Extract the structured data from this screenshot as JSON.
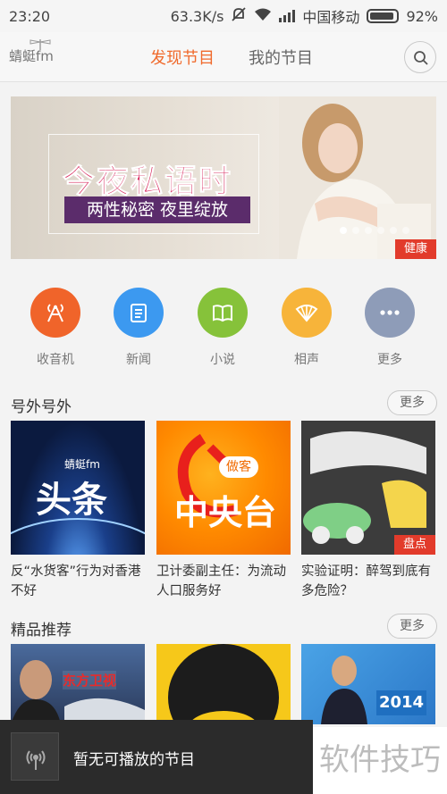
{
  "status_bar": {
    "time": "23:20",
    "net_speed": "63.3K/s",
    "carrier": "中国移动",
    "battery": "92%"
  },
  "app": {
    "logo_text": "蜻蜓fm",
    "tabs": [
      {
        "label": "发现节目",
        "active": true
      },
      {
        "label": "我的节目",
        "active": false
      }
    ],
    "accent_color": "#f06a2c"
  },
  "banner": {
    "title": "今夜私语时",
    "subtitle": "两性秘密 夜里绽放",
    "tag": "健康",
    "page_count": 6,
    "active_page": 1
  },
  "categories": [
    {
      "label": "收音机",
      "color": "#f0642a",
      "icon": "radio-icon"
    },
    {
      "label": "新闻",
      "color": "#3c99f0",
      "icon": "news-icon"
    },
    {
      "label": "小说",
      "color": "#86c23a",
      "icon": "book-icon"
    },
    {
      "label": "相声",
      "color": "#f7b43a",
      "icon": "fan-icon"
    },
    {
      "label": "更多",
      "color": "#8e9cb8",
      "icon": "more-icon"
    }
  ],
  "sections": [
    {
      "title": "号外号外",
      "more": "更多",
      "items": [
        {
          "title": "反“水货客”行为对香港不好",
          "thumb_text": "头条",
          "thumb_logo": "蜻蜓fm"
        },
        {
          "title": "卫计委副主任：为流动人口服务好",
          "thumb_text": "中央台",
          "thumb_tag": "做客"
        },
        {
          "title": "实验证明：醉驾到底有多危险？",
          "badge": "盘点"
        }
      ]
    },
    {
      "title": "精品推荐",
      "more": "更多",
      "items": [
        {
          "thumb_text": "东方卫视"
        },
        {},
        {
          "thumb_text": "2014"
        }
      ]
    }
  ],
  "player": {
    "text": "暂无可播放的节目"
  },
  "watermark": "软件技巧"
}
